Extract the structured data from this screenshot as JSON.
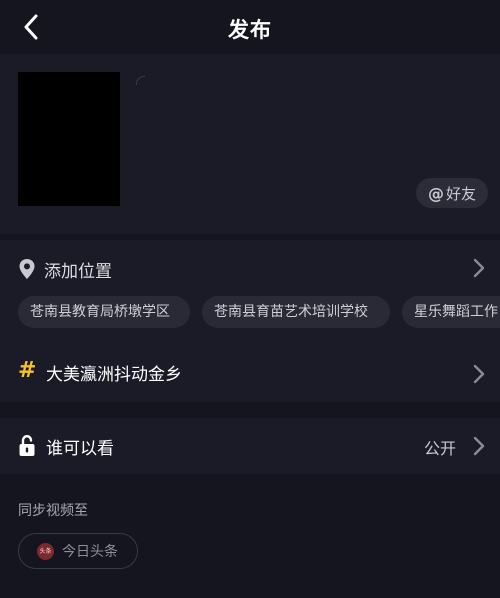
{
  "header": {
    "title": "发布",
    "back_icon": "chevron-left-icon"
  },
  "media": {
    "at_friends_label": "@好友",
    "at_symbol": "@",
    "friends_text": "好友"
  },
  "location": {
    "label": "添加位置",
    "icon": "map-pin-icon",
    "suggestions": [
      "苍南县教育局桥墩学区",
      "苍南县育苗艺术培训学校",
      "星乐舞蹈工作"
    ]
  },
  "topic": {
    "hash_symbol": "#",
    "label": "大美瀛洲抖动金乡",
    "icon_color": "#f4c12e"
  },
  "privacy": {
    "label": "谁可以看",
    "value": "公开",
    "icon": "unlock-icon"
  },
  "sync": {
    "title": "同步视频至",
    "targets": [
      {
        "label": "今日头条",
        "icon": "toutiao-icon",
        "icon_text": "头条"
      }
    ]
  },
  "colors": {
    "background": "#15151f",
    "card": "#1b1b27",
    "chip": "#2a2a36",
    "accent_yellow": "#f4c12e"
  }
}
